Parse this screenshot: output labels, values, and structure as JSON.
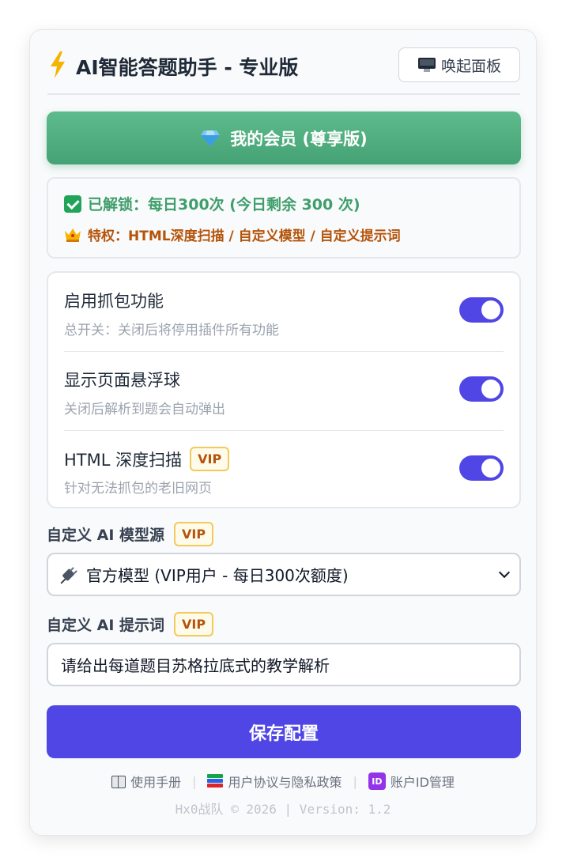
{
  "header": {
    "title": "AI智能答题助手 - 专业版",
    "title_icon": "lightning-icon",
    "open_panel_label": "唤起面板",
    "open_panel_icon": "monitor-icon"
  },
  "membership": {
    "button_label": "我的会员 (尊享版)",
    "button_icon": "gem-icon",
    "unlocked_text": "已解锁：每日300次 (今日剩余 300 次)",
    "unlocked_icon": "check-icon",
    "privilege_text": "特权：HTML深度扫描 / 自定义模型 / 自定义提示词",
    "privilege_icon": "crown-icon"
  },
  "settings": [
    {
      "title": "启用抓包功能",
      "subtitle": "总开关：关闭后将停用插件所有功能",
      "enabled": true,
      "vip": false
    },
    {
      "title": "显示页面悬浮球",
      "subtitle": "关闭后解析到题会自动弹出",
      "enabled": true,
      "vip": false
    },
    {
      "title": "HTML 深度扫描",
      "subtitle": "针对无法抓包的老旧网页",
      "enabled": true,
      "vip": true,
      "vip_label": "VIP"
    }
  ],
  "model": {
    "label": "自定义 AI 模型源",
    "vip_label": "VIP",
    "selected": "官方模型 (VIP用户 - 每日300次额度)",
    "option_icon": "plug-icon"
  },
  "prompt": {
    "label": "自定义 AI 提示词",
    "vip_label": "VIP",
    "value": "请给出每道题目苏格拉底式的教学解析"
  },
  "save_label": "保存配置",
  "footer": {
    "links": [
      {
        "label": "使用手册",
        "icon": "book-icon"
      },
      {
        "label": "用户协议与隐私政策",
        "icon": "books-icon"
      },
      {
        "label": "账户ID管理",
        "icon": "id-icon"
      }
    ],
    "separator": "|",
    "copyright": "Hx0战队 © 2026 | Version: 1.2"
  },
  "colors": {
    "accent": "#4f46e5",
    "member_green": "#45a274",
    "success_text": "#3f9e6c",
    "privilege_text": "#b45309",
    "vip_border": "#f3c95b"
  }
}
